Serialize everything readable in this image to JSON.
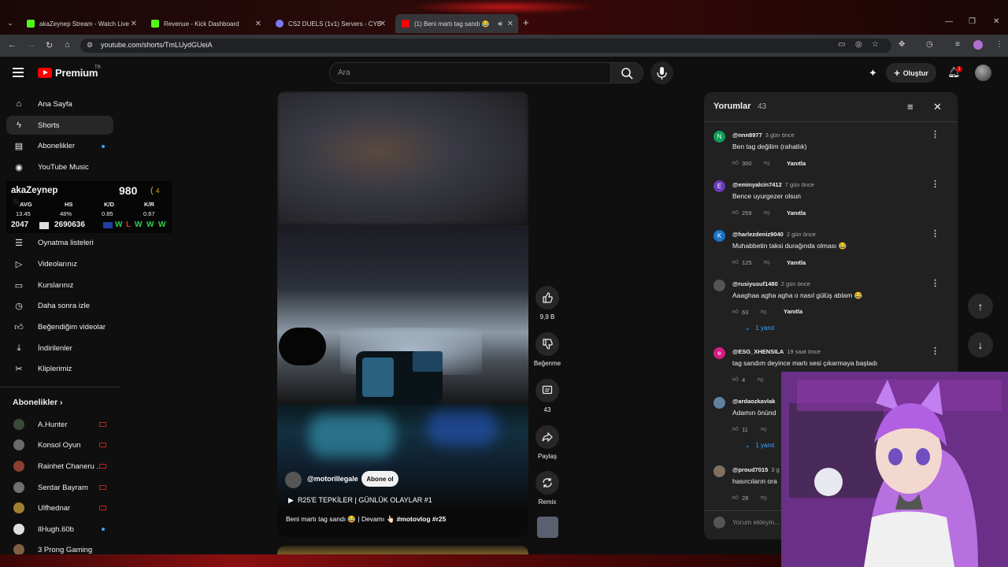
{
  "browser": {
    "tabs": [
      {
        "title": "akaZeynep Stream - Watch Live",
        "favicon_color": "#53fc18"
      },
      {
        "title": "Revenue - Kick Dashboard",
        "favicon_color": "#53fc18"
      },
      {
        "title": "CS2 DUELS (1v1) Servers - CYB",
        "favicon_color": "#7a7af0"
      },
      {
        "title": "(1) Beni martı tag sandı 😂",
        "favicon_color": "#ff0000"
      }
    ],
    "url": "youtube.com/shorts/TmLUydGUeiA"
  },
  "header": {
    "brand": "Premium",
    "region": "TR",
    "search_placeholder": "Ara",
    "create_label": "Oluştur",
    "notif_count": "1"
  },
  "sidebar": {
    "items": [
      {
        "label": "Ana Sayfa",
        "icon": "home-icon"
      },
      {
        "label": "Shorts",
        "icon": "shorts-icon"
      },
      {
        "label": "Abonelikler",
        "icon": "subscriptions-icon"
      },
      {
        "label": "YouTube Music",
        "icon": "music-icon"
      }
    ],
    "partial_label": "Si",
    "library": [
      {
        "label": "Oynatma listeleri",
        "icon": "playlist-icon"
      },
      {
        "label": "Videolarınız",
        "icon": "videos-icon"
      },
      {
        "label": "Kurslarınız",
        "icon": "courses-icon"
      },
      {
        "label": "Daha sonra izle",
        "icon": "clock-icon"
      },
      {
        "label": "Beğendiğim videolar",
        "icon": "thumb-up-icon"
      },
      {
        "label": "İndirilenler",
        "icon": "download-icon"
      },
      {
        "label": "Kliplerimiz",
        "icon": "scissors-icon"
      }
    ],
    "subs_title": "Abonelikler",
    "subscriptions": [
      {
        "label": "A.Hunter",
        "status": "live",
        "color": "#3a4a3a"
      },
      {
        "label": "Konsol Oyun",
        "status": "live",
        "color": "#6a6a6a"
      },
      {
        "label": "Rainhet Chaneru ...",
        "status": "live",
        "color": "#8a4030"
      },
      {
        "label": "Serdar Bayram",
        "status": "live",
        "color": "#707070"
      },
      {
        "label": "Ulfhednar",
        "status": "live",
        "color": "#a08030"
      },
      {
        "label": "IlHugh.60b",
        "status": "new",
        "color": "#e0e0e0"
      },
      {
        "label": "3 Prong Gaming",
        "status": "",
        "color": "#806040"
      }
    ]
  },
  "stream_overlay": {
    "name": "akaZeynep",
    "elo": "980",
    "elo_suffix": "(",
    "elo_extra": "4",
    "headers": [
      "AVG",
      "HS",
      "K/D",
      "K/R"
    ],
    "values": [
      "13.45",
      "48%",
      "0.85",
      "0.67"
    ],
    "left_num": "2047",
    "big_num": "2690636",
    "results": [
      "W",
      "L",
      "W",
      "W",
      "W"
    ]
  },
  "video": {
    "channel": "@motorillegale",
    "subscribe_label": "Abone ol",
    "playlist": "R25'E TEPKİLER | GÜNLÜK OLAYLAR #1",
    "caption_prefix": "Beni martı tag sandı 😂 | Devamı 👆🏻",
    "caption_tags": "#motovlog #r25"
  },
  "actions": {
    "like_count": "9,9 B",
    "dislike_label": "Beğenme",
    "comment_count": "43",
    "share_label": "Paylaş",
    "remix_label": "Remix"
  },
  "comments": {
    "title": "Yorumlar",
    "count": "43",
    "reply_label": "Yanıtla",
    "input_placeholder": "Yorum ekleyin...",
    "items": [
      {
        "initial": "N",
        "color": "#0f9d58",
        "user": "@nnn8977",
        "time": "3 gün önce",
        "text": "Ben tag değilim (rahatlık)",
        "likes": "300",
        "replies": ""
      },
      {
        "initial": "E",
        "color": "#6a3ab8",
        "user": "@eminyalcin7412",
        "time": "7 gün önce",
        "text": "Bence uyurgezer olsun",
        "likes": "259",
        "replies": ""
      },
      {
        "initial": "K",
        "color": "#1a73c8",
        "user": "@harlezdeniz9040",
        "time": "2 gün önce",
        "text": "Muhabbetin taksi durağında olması 😂",
        "likes": "125",
        "replies": ""
      },
      {
        "initial": "",
        "color": "#555555",
        "user": "@rusiyusuf1480",
        "time": "2 gün önce",
        "text": "Aaaghaa agha agha o nasıl gülüş ablam 😂",
        "likes": "63",
        "replies": "1 yanıt"
      },
      {
        "initial": "e",
        "color": "#d81b80",
        "user": "@ESG_XHENSILA",
        "time": "19 saat önce",
        "text": "tag sandım deyince martı sesi çıkarmaya başladı",
        "likes": "4",
        "replies": ""
      },
      {
        "initial": "",
        "color": "#6080a0",
        "user": "@ardaozkavlak",
        "time": "",
        "text": "Adamın önünd",
        "likes": "11",
        "replies": "1 yanıt"
      },
      {
        "initial": "",
        "color": "#807060",
        "user": "@proud7015",
        "time": "3 g",
        "text": "hasırcıların ora",
        "likes": "28",
        "replies": ""
      }
    ]
  }
}
